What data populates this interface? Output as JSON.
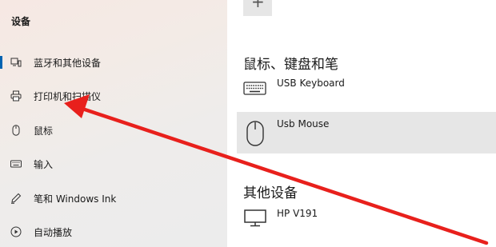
{
  "sidebar": {
    "section_title": "设备",
    "items": [
      {
        "label": "蓝牙和其他设备",
        "icon": "bluetooth-devices-icon",
        "selected": true
      },
      {
        "label": "打印机和扫描仪",
        "icon": "printer-icon",
        "selected": false
      },
      {
        "label": "鼠标",
        "icon": "mouse-icon",
        "selected": false
      },
      {
        "label": "输入",
        "icon": "keyboard-icon",
        "selected": false
      },
      {
        "label": "笔和 Windows Ink",
        "icon": "pen-icon",
        "selected": false
      },
      {
        "label": "自动播放",
        "icon": "autoplay-icon",
        "selected": false
      }
    ]
  },
  "main": {
    "add_label": "+",
    "groups": [
      {
        "heading": "鼠标、键盘和笔",
        "devices": [
          {
            "name": "USB Keyboard",
            "icon": "keyboard-icon",
            "selected": false
          },
          {
            "name": "Usb Mouse",
            "icon": "mouse-icon",
            "selected": true
          }
        ]
      },
      {
        "heading": "其他设备",
        "devices": [
          {
            "name": "HP V191",
            "icon": "monitor-icon",
            "selected": false
          }
        ]
      }
    ]
  },
  "colors": {
    "accent": "#0063b1",
    "annotation_arrow": "#e8201c",
    "selected_bg": "#e6e6e6"
  }
}
